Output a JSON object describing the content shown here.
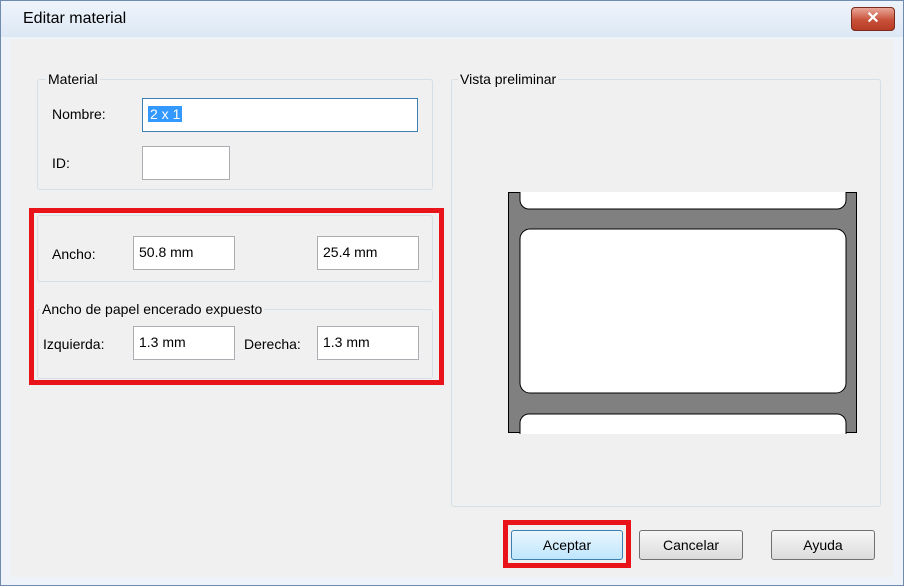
{
  "window": {
    "title": "Editar material",
    "close_glyph": "✕"
  },
  "material_group": {
    "legend": "Material",
    "name_label": "Nombre:",
    "name_value": "2 x 1",
    "id_label": "ID:",
    "id_value": ""
  },
  "size": {
    "width_label": "Ancho:",
    "width_value": "50.8 mm",
    "height_value": "25.4 mm"
  },
  "liner_group": {
    "legend": "Ancho de papel encerado expuesto",
    "left_label": "Izquierda:",
    "left_value": "1.3 mm",
    "right_label": "Derecha:",
    "right_value": "1.3 mm"
  },
  "preview": {
    "legend": "Vista preliminar"
  },
  "buttons": {
    "ok": "Aceptar",
    "cancel": "Cancelar",
    "help": "Ayuda"
  },
  "colors": {
    "highlight": "#e8141a",
    "liner": "#808080",
    "selection": "#3399ff"
  }
}
